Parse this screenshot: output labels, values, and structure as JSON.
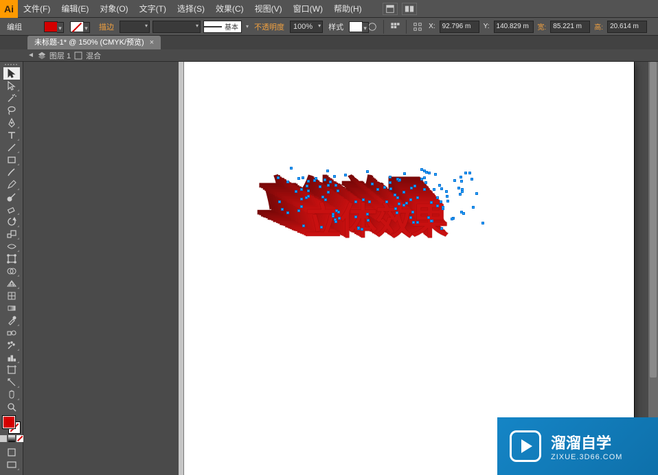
{
  "app": {
    "name": "Ai"
  },
  "menu": {
    "file": "文件(F)",
    "edit": "编辑(E)",
    "object": "对象(O)",
    "type": "文字(T)",
    "select": "选择(S)",
    "effect": "效果(C)",
    "view": "视图(V)",
    "window": "窗口(W)",
    "help": "帮助(H)"
  },
  "control": {
    "object_type": "编组",
    "fill_color": "#d40000",
    "stroke_color": "none",
    "stroke_label": "描边",
    "stroke_weight": "",
    "brush": "",
    "preset_label": "基本",
    "opacity_label": "不透明度",
    "opacity_value": "100%",
    "style_label": "样式",
    "x_label": "X:",
    "x_value": "92.796 m",
    "y_label": "Y:",
    "y_value": "140.829 m",
    "w_label": "宽:",
    "w_value": "85.221 m",
    "h_label": "高:",
    "h_value": "20.614 m"
  },
  "doc_tab": {
    "title": "未标题-1* @ 150% (CMYK/预览)"
  },
  "breadcrumb": {
    "layer": "图层 1",
    "item": "混合"
  },
  "artwork": {
    "text": "立体效果"
  },
  "watermark": {
    "brand": "溜溜自学",
    "url": "ZIXUE.3D66.COM"
  },
  "tool_names": [
    "selection-tool",
    "direct-selection-tool",
    "magic-wand-tool",
    "lasso-tool",
    "pen-tool",
    "type-tool",
    "line-tool",
    "rectangle-tool",
    "paintbrush-tool",
    "pencil-tool",
    "blob-brush-tool",
    "eraser-tool",
    "rotate-tool",
    "scale-tool",
    "width-tool",
    "free-transform-tool",
    "shape-builder-tool",
    "perspective-grid-tool",
    "mesh-tool",
    "gradient-tool",
    "eyedropper-tool",
    "blend-tool",
    "symbol-sprayer-tool",
    "column-graph-tool",
    "artboard-tool",
    "slice-tool",
    "hand-tool",
    "zoom-tool"
  ]
}
